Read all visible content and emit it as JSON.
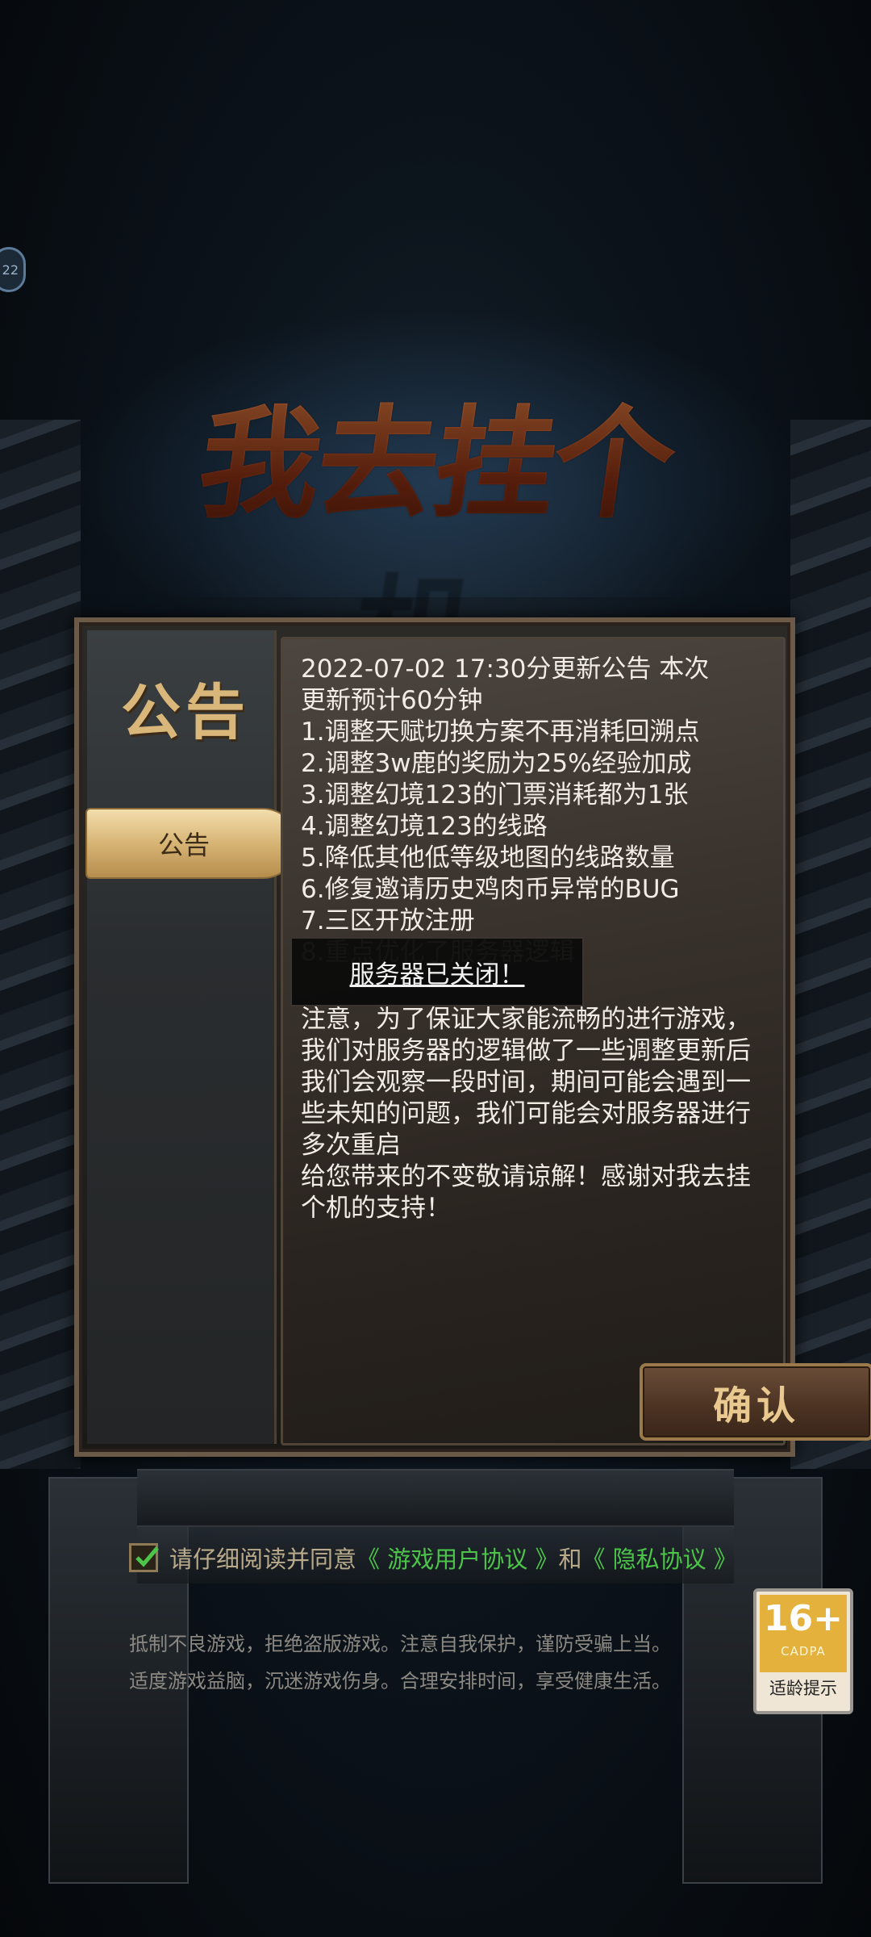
{
  "status_badge": "22",
  "logo_text": "我去挂个机",
  "dialog": {
    "title": "公告",
    "tab_label": "公告",
    "notice_lines": [
      "2022-07-02 17:30分更新公告 本次",
      "更新预计60分钟",
      "1.调整天赋切换方案不再消耗回溯点",
      "2.调整3w鹿的奖励为25%经验加成",
      "3.调整幻境123的门票消耗都为1张",
      "4.调整幻境123的线路",
      "5.降低其他低等级地图的线路数量",
      "6.修复邀请历史鸡肉币异常的BUG",
      "7.三区开放注册",
      "8.重点优化了服务器逻辑"
    ],
    "notice_paragraph": "注意，为了保证大家能流畅的进行游戏，我们对服务器的逻辑做了一些调整更新后我们会观察一段时间，期间可能会遇到一些未知的问题，我们可能会对服务器进行多次重启",
    "notice_closing": "给您带来的不变敬请谅解！感谢对我去挂个机的支持！",
    "toast": "服务器已关闭！",
    "confirm_label": "确认"
  },
  "agreement": {
    "checked": true,
    "prefix": "请仔细阅读并同意",
    "link_terms": "《 游戏用户协议 》",
    "conjunction": "和",
    "link_privacy": "《 隐私协议 》"
  },
  "disclaimer": [
    "抵制不良游戏，拒绝盗版游戏。注意自我保护，谨防受骗上当。",
    "适度游戏益脑，沉迷游戏伤身。合理安排时间，享受健康生活。"
  ],
  "age_rating": {
    "age": "16+",
    "org": "CADPA",
    "tip": "适龄提示"
  },
  "colors": {
    "link": "#4cc44a",
    "tab_gold": "#d4b070",
    "title_gold": "#d9b67a"
  }
}
